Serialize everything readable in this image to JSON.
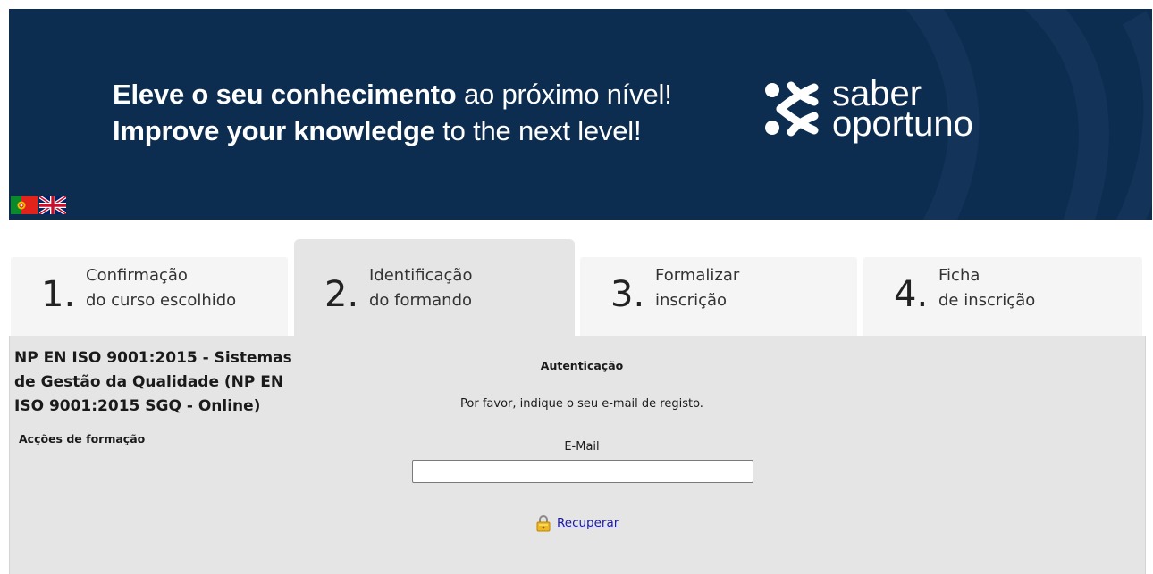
{
  "banner": {
    "line1_bold": "Eleve o seu conhecimento",
    "line1_rest": " ao próximo nível!",
    "line2_bold": "Improve your knowledge",
    "line2_rest": " to the next level!",
    "brand_line1": "saber",
    "brand_line2": "oportuno",
    "background_color": "#0d2d50"
  },
  "languages": [
    {
      "code": "pt",
      "icon": "portugal-flag-icon"
    },
    {
      "code": "en",
      "icon": "uk-flag-icon"
    }
  ],
  "steps": [
    {
      "number": "1.",
      "line1": "Confirmação",
      "line2": "do curso escolhido",
      "active": false
    },
    {
      "number": "2.",
      "line1": "Identificação",
      "line2": "do formando",
      "active": true
    },
    {
      "number": "3.",
      "line1": "Formalizar",
      "line2": "inscrição",
      "active": false
    },
    {
      "number": "4.",
      "line1": "Ficha",
      "line2": "de inscrição",
      "active": false
    }
  ],
  "course": {
    "title": "NP EN ISO 9001:2015 - Sistemas de Gestão da Qualidade (NP EN ISO 9001:2015 SGQ - Online)",
    "actions_label": "Acções de formação"
  },
  "auth": {
    "title": "Autenticação",
    "instructions": "Por favor, indique o seu e-mail de registo.",
    "email_label": "E-Mail",
    "email_value": "",
    "recover_label": "Recuperar",
    "recover_icon": "lock-icon"
  },
  "colors": {
    "panel": "#e6e5e5",
    "tab_inactive": "#f5f5f5",
    "link": "#1a1aa6"
  }
}
